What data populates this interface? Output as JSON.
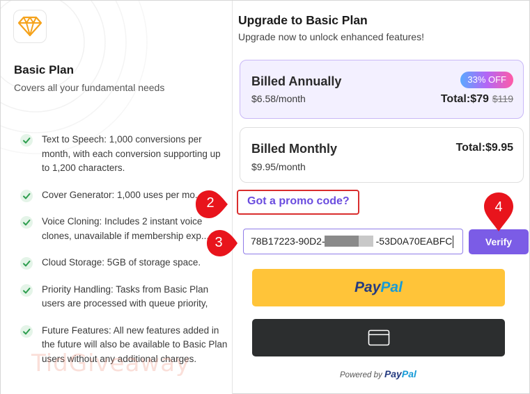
{
  "left": {
    "plan_title": "Basic Plan",
    "plan_subtitle": "Covers all your fundamental needs",
    "features": [
      {
        "text": "Text to Speech: 1,000 conversions per\nmonth, with each conversion supporting up\nto 1,200 characters."
      },
      {
        "text": "Cover Generator: 1,000 uses per mo..."
      },
      {
        "text": "Voice Cloning: Includes 2 instant voice\nclones, unavailable if membership exp..."
      },
      {
        "text": "Cloud Storage: 5GB of storage space."
      },
      {
        "text": "Priority Handling: Tasks from Basic Plan\nusers are processed with queue priority,"
      },
      {
        "text": "Future Features: All new features added in\nthe future will also be available to Basic Plan\nusers without any additional charges."
      }
    ],
    "watermark": "TidGiveaway"
  },
  "right": {
    "title": "Upgrade to Basic Plan",
    "subtitle": "Upgrade now to unlock enhanced features!",
    "annual": {
      "name": "Billed Annually",
      "price": "$6.58/month",
      "discount": "33% OFF",
      "total": "Total:$79",
      "original": "$119"
    },
    "monthly": {
      "name": "Billed Monthly",
      "price": "$9.95/month",
      "total": "Total:$9.95"
    },
    "promo_link": "Got a promo code?",
    "code_prefix": "78B17223-90D2-",
    "code_suffix": "-53D0A70EABFC",
    "verify_label": "Verify",
    "paypal_pay": "Pay",
    "paypal_pal": "Pal",
    "powered_by": "Powered by",
    "powered_brand_a": "Pay",
    "powered_brand_b": "Pal"
  },
  "markers": {
    "m2": "2",
    "m3": "3",
    "m4": "4"
  },
  "colors": {
    "accent": "#7b5ce6",
    "paypal_yellow": "#ffc439",
    "card_dark": "#2c2e2f",
    "marker_red": "#e8141c",
    "check_green": "#2e9e4f"
  }
}
